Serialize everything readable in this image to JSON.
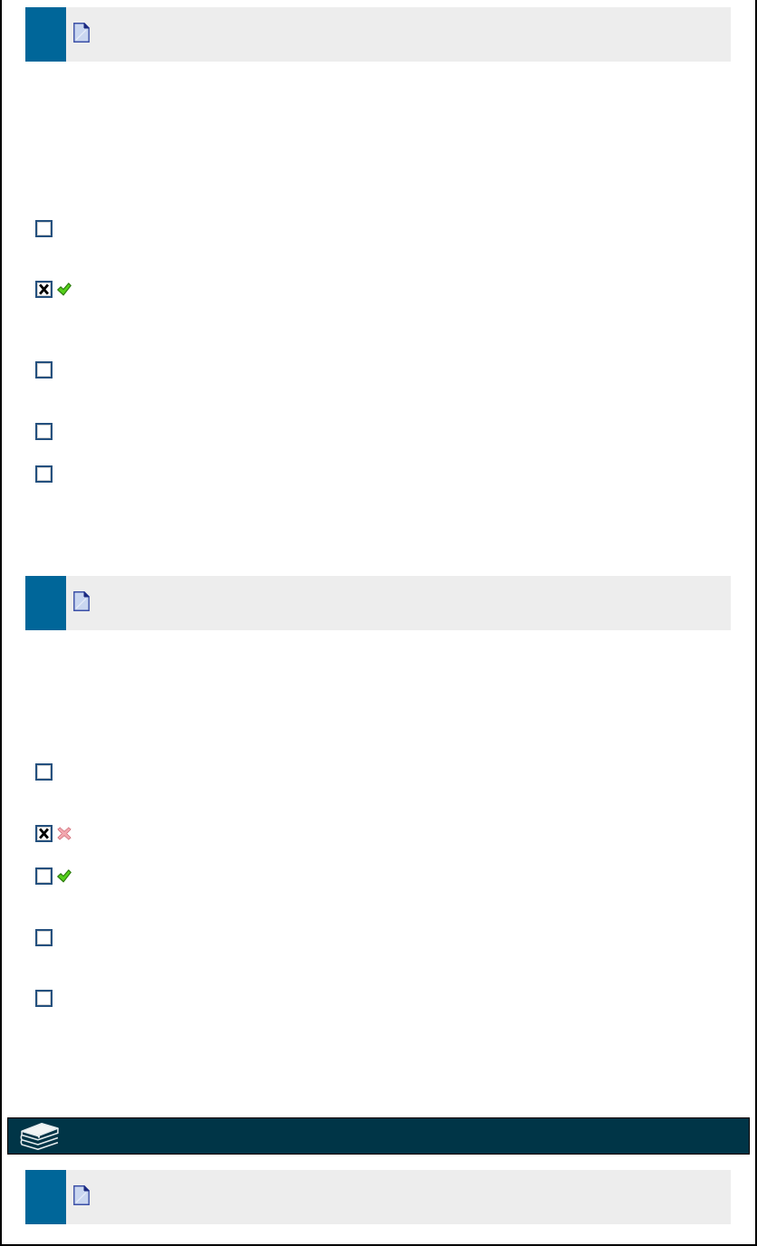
{
  "blocks": [
    {
      "kind": "question",
      "options": [
        {
          "checked": false,
          "correct_mark": false,
          "wrong_mark": false
        },
        {
          "checked": true,
          "correct_mark": true,
          "wrong_mark": false
        },
        {
          "checked": false,
          "correct_mark": false,
          "wrong_mark": false
        },
        {
          "checked": false,
          "correct_mark": false,
          "wrong_mark": false
        },
        {
          "checked": false,
          "correct_mark": false,
          "wrong_mark": false
        }
      ]
    },
    {
      "kind": "question",
      "options": [
        {
          "checked": false,
          "correct_mark": false,
          "wrong_mark": false
        },
        {
          "checked": true,
          "correct_mark": false,
          "wrong_mark": true
        },
        {
          "checked": false,
          "correct_mark": true,
          "wrong_mark": false
        },
        {
          "checked": false,
          "correct_mark": false,
          "wrong_mark": false
        },
        {
          "checked": false,
          "correct_mark": false,
          "wrong_mark": false
        }
      ]
    },
    {
      "kind": "banner"
    },
    {
      "kind": "question"
    }
  ]
}
